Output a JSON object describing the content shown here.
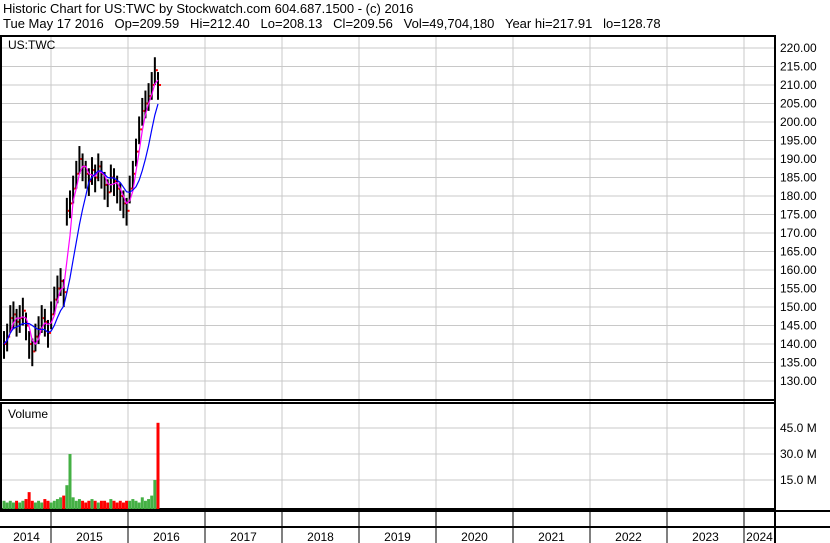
{
  "header": {
    "line1": "Historic Chart for US:TWC by Stockwatch.com 604.687.1500 - (c) 2016",
    "line2": "Tue May 17 2016   Op=209.59   Hi=212.40   Lo=208.13   Cl=209.56   Vol=49,704,180   Year hi=217.91   lo=128.78"
  },
  "chart_data": {
    "type": "line",
    "symbol": "US:TWC",
    "volume_label": "Volume",
    "x_start": "2014-05",
    "x_end": "2016-05",
    "price_ticks": [
      "220.00",
      "215.00",
      "210.00",
      "205.00",
      "200.00",
      "195.00",
      "190.00",
      "185.00",
      "180.00",
      "175.00",
      "170.00",
      "165.00",
      "160.00",
      "155.00",
      "150.00",
      "145.00",
      "140.00",
      "135.00",
      "130.00"
    ],
    "ylim": [
      130,
      220
    ],
    "volume_ticks": [
      "45.0 M",
      "30.0 M",
      "15.0 M"
    ],
    "years": [
      "2014",
      "2015",
      "2016",
      "2017",
      "2018",
      "2019",
      "2020",
      "2021",
      "2022",
      "2023",
      "2024"
    ],
    "close": [
      140,
      142,
      147,
      148,
      146,
      147,
      149,
      145,
      140,
      138,
      142,
      144,
      147,
      146,
      143,
      148,
      152,
      155,
      157,
      154,
      176,
      178,
      182,
      186,
      190,
      188,
      186,
      184,
      187,
      185,
      188,
      186,
      183,
      181,
      185,
      184,
      182,
      180,
      178,
      176,
      182,
      186,
      192,
      198,
      203,
      205,
      207,
      210,
      214,
      210
    ],
    "volume_m": [
      3,
      2,
      3,
      2,
      3,
      2,
      3,
      4,
      8,
      3,
      2,
      3,
      2,
      4,
      3,
      2,
      3,
      4,
      5,
      6,
      12,
      30,
      5,
      3,
      4,
      3,
      2,
      3,
      4,
      3,
      2,
      3,
      3,
      2,
      4,
      3,
      2,
      3,
      2,
      3,
      3,
      4,
      3,
      2,
      5,
      3,
      4,
      6,
      15,
      48
    ],
    "colors": {
      "price": "#000000",
      "short_ma": "#ff00ff",
      "long_ma": "#0000ff",
      "up": "#44b044",
      "down": "#ff0000",
      "grid": "#c8c8c8"
    }
  }
}
